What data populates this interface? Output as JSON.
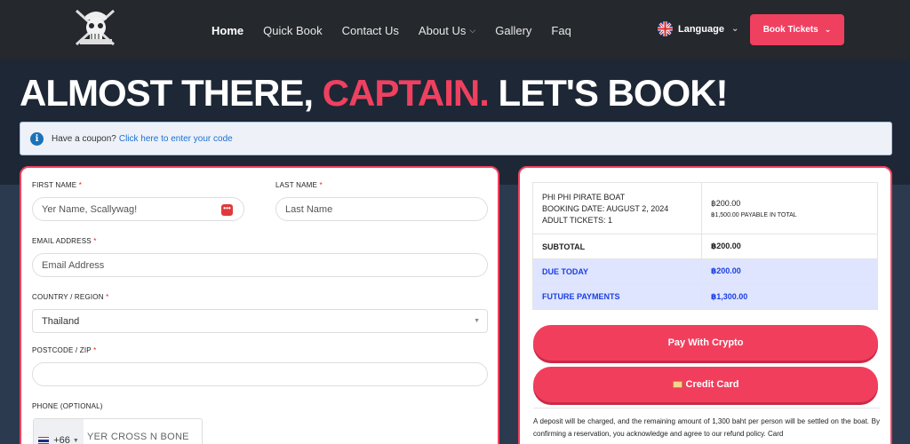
{
  "nav": {
    "links": [
      {
        "label": "Home"
      },
      {
        "label": "Quick Book"
      },
      {
        "label": "Contact Us"
      },
      {
        "label": "About Us"
      },
      {
        "label": "Gallery"
      },
      {
        "label": "Faq"
      }
    ],
    "language_label": "Language",
    "book_label": "Book Tickets"
  },
  "hero": {
    "part1": "ALMOST THERE, ",
    "accent": "CAPTAIN.",
    "part2": " LET'S BOOK!"
  },
  "coupon": {
    "text": "Have a coupon?",
    "link": "Click here to enter your code"
  },
  "form": {
    "first_name": {
      "label": "FIRST NAME",
      "placeholder": "Yer Name, Scallywag!"
    },
    "last_name": {
      "label": "LAST NAME",
      "placeholder": "Last Name"
    },
    "email": {
      "label": "EMAIL ADDRESS",
      "placeholder": "Email Address"
    },
    "country": {
      "label": "COUNTRY / REGION",
      "value": "Thailand"
    },
    "postcode": {
      "label": "POSTCODE / ZIP",
      "value": ""
    },
    "phone": {
      "label": "PHONE (OPTIONAL)",
      "code": "+66",
      "placeholder": "YER CROSS N BONE"
    },
    "required_mark": "*"
  },
  "order": {
    "product": "PHI PHI PIRATE BOAT",
    "booking_date": "BOOKING DATE: AUGUST 2, 2024",
    "adult_tickets": "ADULT TICKETS: 1",
    "price": "฿200.00",
    "payable_note": "฿1,500.00 PAYABLE IN TOTAL",
    "subtotal_label": "SUBTOTAL",
    "subtotal_value": "฿200.00",
    "due_label": "DUE TODAY",
    "due_value": "฿200.00",
    "future_label": "FUTURE PAYMENTS",
    "future_value": "฿1,300.00",
    "pay_crypto": "Pay With Crypto",
    "credit_card": "Credit Card",
    "disclaimer": "A deposit will be charged, and the remaining amount of 1,300 baht per person will be settled on the boat. By confirming a reservation, you acknowledge and agree to our refund policy. Card"
  },
  "colors": {
    "accent": "#f0405f",
    "nav_bg": "#25282c",
    "link_blue": "#1a6fd6",
    "due_blue": "#1a3fe0"
  }
}
